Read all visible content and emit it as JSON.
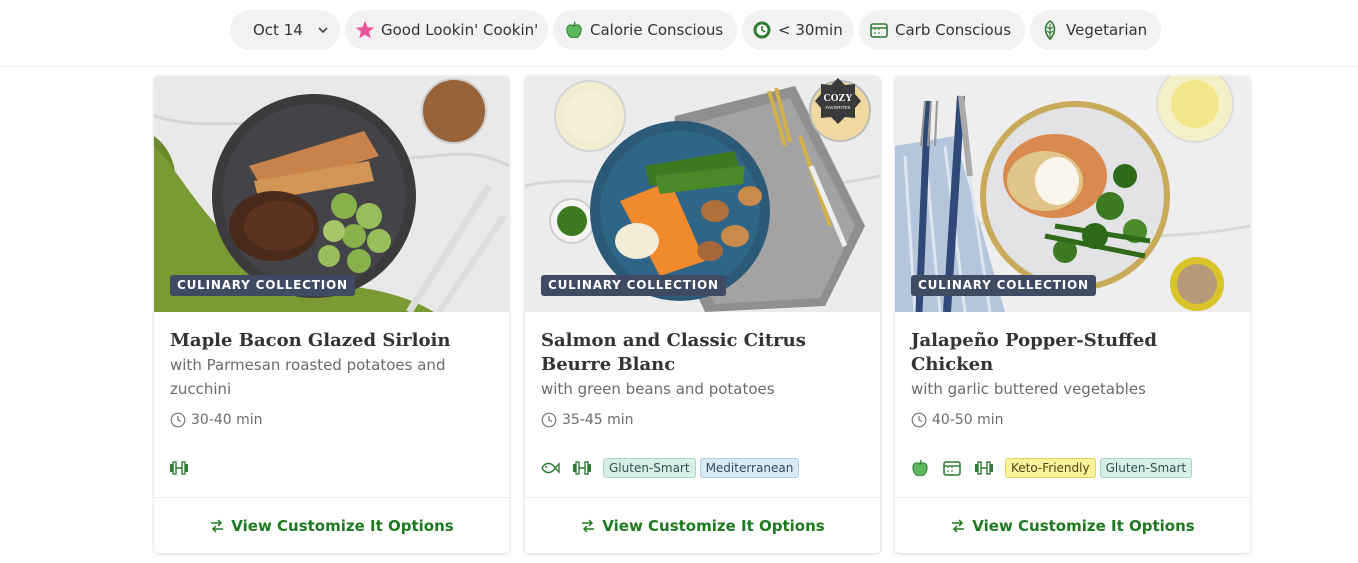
{
  "filters": {
    "date": {
      "label": "Oct 14",
      "icon": "chevron-down-icon"
    },
    "chips": [
      {
        "label": "Good Lookin' Cookin'",
        "icon": "star-icon",
        "color": "#e9579a"
      },
      {
        "label": "Calorie Conscious",
        "icon": "apple-icon",
        "color": "#4caf50"
      },
      {
        "label": "< 30min",
        "icon": "timer-icon",
        "color": "#2e7d32"
      },
      {
        "label": "Carb Conscious",
        "icon": "bread-icon",
        "color": "#2e7d32"
      },
      {
        "label": "Vegetarian",
        "icon": "leaf-icon",
        "color": "#2e7d32"
      }
    ]
  },
  "cards": [
    {
      "collection": "CULINARY COLLECTION",
      "title": "Maple Bacon Glazed Sirloin",
      "subtitle": "with Parmesan roasted potatoes and zucchini",
      "time": "30-40 min",
      "tag_icons": [
        "dumbbell-icon"
      ],
      "tags": [],
      "cta": "View Customize It Options"
    },
    {
      "collection": "CULINARY COLLECTION",
      "badge": "COZY FAVORITES",
      "title": "Salmon and Classic Citrus Beurre Blanc",
      "subtitle": "with green beans and potatoes",
      "time": "35-45 min",
      "tag_icons": [
        "fish-icon",
        "dumbbell-icon"
      ],
      "tags": [
        "Gluten-Smart",
        "Mediterranean"
      ],
      "cta": "View Customize It Options"
    },
    {
      "collection": "CULINARY COLLECTION",
      "title": "Jalapeño Popper-Stuffed Chicken",
      "subtitle": "with garlic buttered vegetables",
      "time": "40-50 min",
      "tag_icons": [
        "apple-icon",
        "bread-icon",
        "dumbbell-icon"
      ],
      "tags": [
        "Keto-Friendly",
        "Gluten-Smart"
      ],
      "cta": "View Customize It Options"
    }
  ],
  "colors": {
    "accent_green": "#1e7a1e",
    "badge_bg": "#3f4a63",
    "chip_bg": "#f2f2f2"
  }
}
